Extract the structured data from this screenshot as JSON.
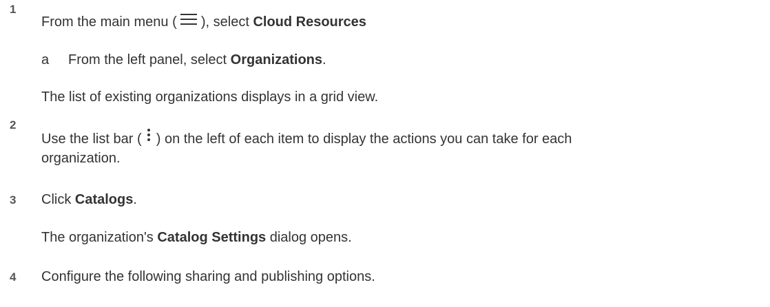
{
  "steps": [
    {
      "number": "1",
      "line1": {
        "pre": "From the main menu ( ",
        "post": " ), select ",
        "bold": "Cloud Resources"
      },
      "substep": {
        "letter": "a",
        "pre": "From the left panel, select ",
        "bold": "Organizations",
        "post": "."
      },
      "note": "The list of existing organizations displays in a grid view."
    },
    {
      "number": "2",
      "line1": {
        "pre": "Use the list bar ( ",
        "post": " ) on the left of each item to display the actions you can take for each"
      },
      "line2": "organization."
    },
    {
      "number": "3",
      "line1": {
        "pre": "Click ",
        "bold": "Catalogs",
        "post": "."
      },
      "note": {
        "pre": "The organization's ",
        "bold": "Catalog Settings",
        "post": " dialog opens."
      }
    },
    {
      "number": "4",
      "line1": "Configure the following sharing and publishing options."
    }
  ],
  "icons": {
    "menu": "hamburger-menu-icon",
    "list_bar": "vertical-ellipsis-icon"
  }
}
